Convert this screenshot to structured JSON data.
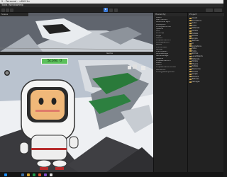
{
  "window": {
    "title": "2 - Personal - <DX11>"
  },
  "menu": {
    "items": [
      "Tools",
      "Window",
      "Help"
    ]
  },
  "scene": {
    "tab_label": "Scene"
  },
  "game": {
    "tab_label": "Game",
    "score_text": "Score: 0"
  },
  "hierarchy": {
    "tab_label": "Hierarchy",
    "items": [
      "Level1",
      "Main Camera",
      "Directional Light",
      "Checkpoint",
      "PrototypeCorridor",
      "Spawner",
      "Coin",
      "WindTrap",
      "Player",
      "Ground",
      "PropellerPlatform",
      "MovingPlatform",
      "Blocks",
      "Environment",
      "Canvas",
      "EventSystem",
      "AudioManager",
      "GameManager",
      "Spawner",
      "PropellerPlatform",
      "Level2",
      "Level3",
      "PropellerPlatformOffset",
      "DanceFloor",
      "PrototypeRampOffset"
    ]
  },
  "project": {
    "tab_label": "Project",
    "items": [
      "Assets",
      "Animations",
      "Audio",
      "Fonts",
      "Materials",
      "Models",
      "Prefabs",
      "Scenes",
      "Scripts",
      "Textures",
      "UI",
      "Animations",
      "Editor",
      "Fonts",
      "Gizmos",
      "LevelObjects",
      "Materials",
      "Models",
      "Physics",
      "Prefabs",
      "Resources",
      "Scenes",
      "Scripts",
      "Shaders",
      "Textures",
      "Packages"
    ]
  },
  "colors": {
    "accent": "#3d7bd8",
    "score_bg": "#5bc05b",
    "folder": "#c9a24d"
  }
}
